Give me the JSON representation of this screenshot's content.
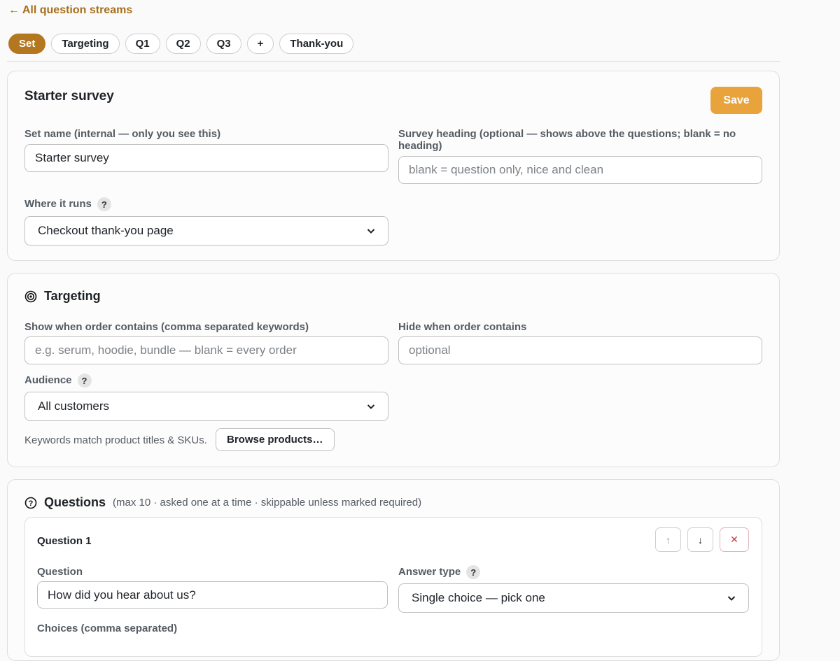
{
  "nav": {
    "back_link": "← All question streams"
  },
  "tabs": [
    "Set",
    "Targeting",
    "Q1",
    "Q2",
    "Q3",
    "+",
    "Thank-you"
  ],
  "set_card": {
    "title": "Starter survey",
    "save_label": "Save",
    "set_name_label": "Set name (internal — only you see this)",
    "set_name_value": "Starter survey",
    "heading_label": "Survey heading (optional — shows above the questions; blank = no heading)",
    "heading_placeholder": "blank = question only, nice and clean",
    "where_label": "Where it runs",
    "where_value": "Checkout thank-you page",
    "help": "?"
  },
  "targeting": {
    "title": "Targeting",
    "show_label": "Show when order contains (comma separated keywords)",
    "show_placeholder": "e.g. serum, hoodie, bundle — blank = every order",
    "hide_label": "Hide when order contains",
    "hide_placeholder": "optional",
    "audience_label": "Audience",
    "audience_value": "All customers",
    "hint": "Keywords match product titles & SKUs.",
    "browse_label": "Browse products…",
    "help": "?"
  },
  "questions": {
    "title": "Questions",
    "subtitle": "(max 10 · asked one at a time · skippable unless marked required)",
    "q1": {
      "title": "Question 1",
      "up": "↑",
      "down": "↓",
      "remove": "✕",
      "question_label": "Question",
      "question_value": "How did you hear about us?",
      "answer_type_label": "Answer type",
      "answer_type_value": "Single choice — pick one",
      "choices_label": "Choices (comma separated)",
      "help": "?"
    }
  },
  "colors": {
    "accent": "#b3771f",
    "save": "#e8a33c",
    "danger": "#c93a3f"
  }
}
